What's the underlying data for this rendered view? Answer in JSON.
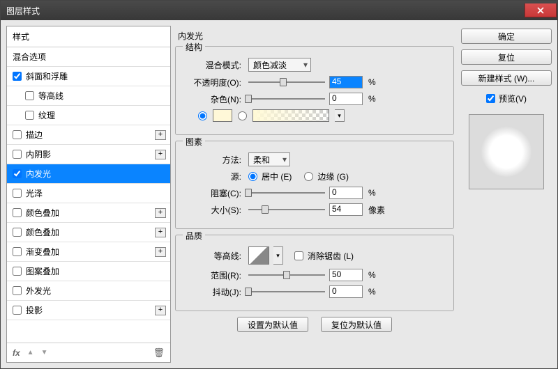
{
  "window": {
    "title": "图层样式"
  },
  "left": {
    "header": "样式",
    "blend_options": "混合选项",
    "items": [
      {
        "label": "斜面和浮雕",
        "checked": true,
        "plus": false,
        "indent": false
      },
      {
        "label": "等高线",
        "checked": false,
        "plus": false,
        "indent": true
      },
      {
        "label": "纹理",
        "checked": false,
        "plus": false,
        "indent": true
      },
      {
        "label": "描边",
        "checked": false,
        "plus": true,
        "indent": false
      },
      {
        "label": "内阴影",
        "checked": false,
        "plus": true,
        "indent": false
      },
      {
        "label": "内发光",
        "checked": true,
        "plus": false,
        "indent": false,
        "selected": true
      },
      {
        "label": "光泽",
        "checked": false,
        "plus": false,
        "indent": false
      },
      {
        "label": "颜色叠加",
        "checked": false,
        "plus": true,
        "indent": false
      },
      {
        "label": "颜色叠加",
        "checked": false,
        "plus": true,
        "indent": false
      },
      {
        "label": "渐变叠加",
        "checked": false,
        "plus": true,
        "indent": false
      },
      {
        "label": "图案叠加",
        "checked": false,
        "plus": false,
        "indent": false
      },
      {
        "label": "外发光",
        "checked": false,
        "plus": false,
        "indent": false
      },
      {
        "label": "投影",
        "checked": false,
        "plus": true,
        "indent": false
      }
    ],
    "footer_fx": "fx"
  },
  "center": {
    "title": "内发光",
    "structure": {
      "legend": "结构",
      "blend_mode_label": "混合模式:",
      "blend_mode_value": "颜色减淡",
      "opacity_label": "不透明度(O):",
      "opacity_value": "45",
      "opacity_unit": "%",
      "noise_label": "杂色(N):",
      "noise_value": "0",
      "noise_unit": "%"
    },
    "elements": {
      "legend": "图素",
      "technique_label": "方法:",
      "technique_value": "柔和",
      "source_label": "源:",
      "source_center": "居中 (E)",
      "source_edge": "边缘 (G)",
      "choke_label": "阻塞(C):",
      "choke_value": "0",
      "choke_unit": "%",
      "size_label": "大小(S):",
      "size_value": "54",
      "size_unit": "像素"
    },
    "quality": {
      "legend": "品质",
      "contour_label": "等高线:",
      "antialias_label": "消除锯齿 (L)",
      "range_label": "范围(R):",
      "range_value": "50",
      "range_unit": "%",
      "jitter_label": "抖动(J):",
      "jitter_unit": "%",
      "jitter_value": "0"
    },
    "make_default": "设置为默认值",
    "reset_default": "复位为默认值"
  },
  "right": {
    "ok": "确定",
    "reset": "复位",
    "new_style": "新建样式 (W)...",
    "preview_label": "预览(V)"
  }
}
